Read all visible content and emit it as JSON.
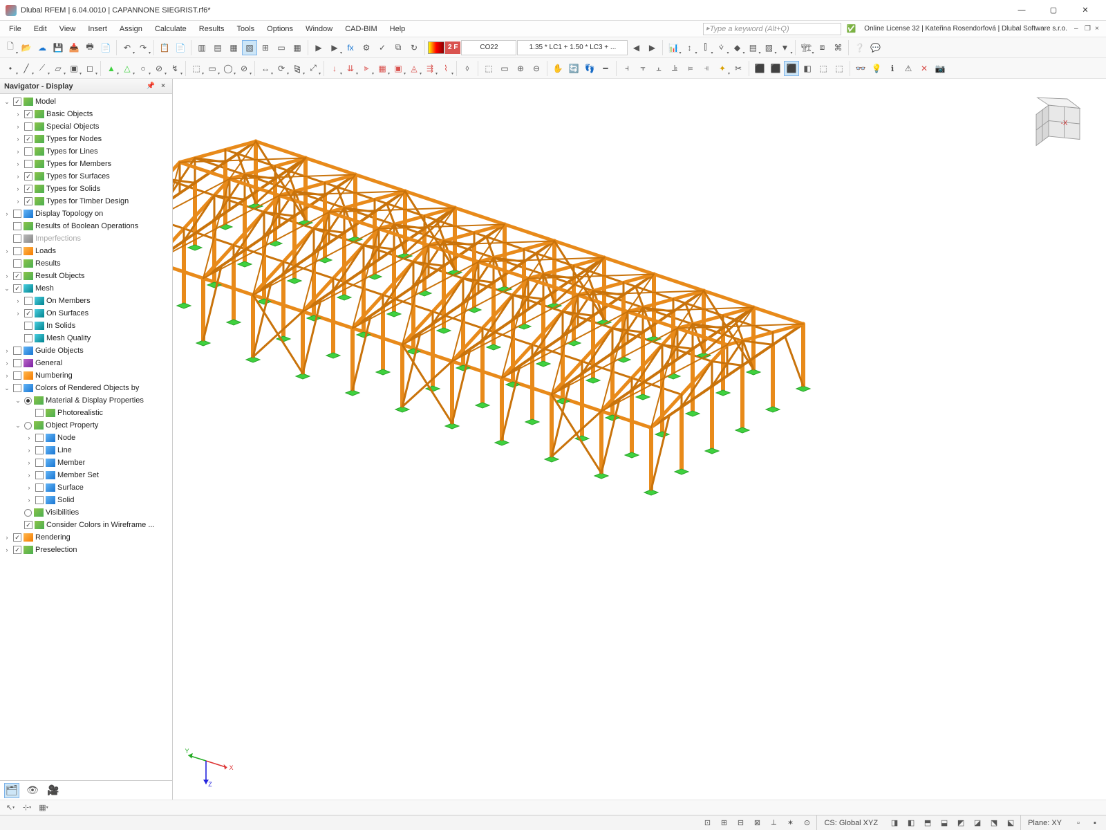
{
  "title": "Dlubal RFEM | 6.04.0010 | CAPANNONE SIEGRIST.rf6*",
  "menus": [
    "File",
    "Edit",
    "View",
    "Insert",
    "Assign",
    "Calculate",
    "Results",
    "Tools",
    "Options",
    "Window",
    "CAD-BIM",
    "Help"
  ],
  "search_placeholder": "Type a keyword (Alt+Q)",
  "license_text": "Online License 32 | Kateřina Rosendorfová | Dlubal Software s.r.o.",
  "toolbar1_combo1": "CO22",
  "toolbar1_combo2": "1.35 * LC1 + 1.50 * LC3 + ...",
  "toolbar1_badge": "2 F",
  "navigator": {
    "title": "Navigator - Display",
    "tree": [
      {
        "d": 0,
        "exp": "open",
        "chk": true,
        "ic": "green",
        "label": "Model"
      },
      {
        "d": 1,
        "exp": "closed",
        "chk": true,
        "ic": "green",
        "label": "Basic Objects"
      },
      {
        "d": 1,
        "exp": "closed",
        "chk": false,
        "ic": "green",
        "label": "Special Objects"
      },
      {
        "d": 1,
        "exp": "closed",
        "chk": true,
        "ic": "green",
        "label": "Types for Nodes"
      },
      {
        "d": 1,
        "exp": "closed",
        "chk": false,
        "ic": "green",
        "label": "Types for Lines"
      },
      {
        "d": 1,
        "exp": "closed",
        "chk": false,
        "ic": "green",
        "label": "Types for Members"
      },
      {
        "d": 1,
        "exp": "closed",
        "chk": true,
        "ic": "green",
        "label": "Types for Surfaces"
      },
      {
        "d": 1,
        "exp": "closed",
        "chk": true,
        "ic": "green",
        "label": "Types for Solids"
      },
      {
        "d": 1,
        "exp": "closed",
        "chk": true,
        "ic": "green",
        "label": "Types for Timber Design"
      },
      {
        "d": 0,
        "exp": "closed",
        "chk": false,
        "ic": "blue",
        "label": "Display Topology on"
      },
      {
        "d": 0,
        "exp": "leaf",
        "chk": false,
        "ic": "green",
        "label": "Results of Boolean Operations"
      },
      {
        "d": 0,
        "exp": "leaf",
        "chk": false,
        "ic": "grey",
        "label": "Imperfections",
        "dim": true
      },
      {
        "d": 0,
        "exp": "closed",
        "chk": false,
        "ic": "orange",
        "label": "Loads"
      },
      {
        "d": 0,
        "exp": "leaf",
        "chk": false,
        "ic": "green",
        "label": "Results"
      },
      {
        "d": 0,
        "exp": "closed",
        "chk": true,
        "ic": "green",
        "label": "Result Objects"
      },
      {
        "d": 0,
        "exp": "open",
        "chk": true,
        "ic": "teal",
        "label": "Mesh"
      },
      {
        "d": 1,
        "exp": "closed",
        "chk": false,
        "ic": "teal",
        "label": "On Members"
      },
      {
        "d": 1,
        "exp": "closed",
        "chk": true,
        "ic": "teal",
        "label": "On Surfaces"
      },
      {
        "d": 1,
        "exp": "leaf",
        "chk": false,
        "ic": "teal",
        "label": "In Solids"
      },
      {
        "d": 1,
        "exp": "leaf",
        "chk": false,
        "ic": "teal",
        "label": "Mesh Quality"
      },
      {
        "d": 0,
        "exp": "closed",
        "chk": false,
        "ic": "blue",
        "label": "Guide Objects"
      },
      {
        "d": 0,
        "exp": "closed",
        "chk": false,
        "ic": "purple",
        "label": "General"
      },
      {
        "d": 0,
        "exp": "closed",
        "chk": false,
        "ic": "orange",
        "label": "Numbering"
      },
      {
        "d": 0,
        "exp": "open",
        "chk": false,
        "ic": "blue",
        "label": "Colors of Rendered Objects by"
      },
      {
        "d": 1,
        "exp": "open",
        "radio": true,
        "rchk": true,
        "ic": "green",
        "label": "Material & Display Properties"
      },
      {
        "d": 2,
        "exp": "leaf",
        "chk": false,
        "ic": "green",
        "label": "Photorealistic"
      },
      {
        "d": 1,
        "exp": "open",
        "radio": true,
        "rchk": false,
        "ic": "green",
        "label": "Object Property"
      },
      {
        "d": 2,
        "exp": "closed",
        "chk": false,
        "ic": "blue",
        "label": "Node"
      },
      {
        "d": 2,
        "exp": "closed",
        "chk": false,
        "ic": "blue",
        "label": "Line"
      },
      {
        "d": 2,
        "exp": "closed",
        "chk": false,
        "ic": "blue",
        "label": "Member"
      },
      {
        "d": 2,
        "exp": "closed",
        "chk": false,
        "ic": "blue",
        "label": "Member Set"
      },
      {
        "d": 2,
        "exp": "closed",
        "chk": false,
        "ic": "blue",
        "label": "Surface"
      },
      {
        "d": 2,
        "exp": "closed",
        "chk": false,
        "ic": "blue",
        "label": "Solid"
      },
      {
        "d": 1,
        "exp": "leaf",
        "radio": true,
        "rchk": false,
        "ic": "green",
        "label": "Visibilities"
      },
      {
        "d": 1,
        "exp": "leaf",
        "chk": true,
        "ic": "green",
        "label": "Consider Colors in Wireframe ..."
      },
      {
        "d": 0,
        "exp": "closed",
        "chk": true,
        "ic": "orange",
        "label": "Rendering"
      },
      {
        "d": 0,
        "exp": "closed",
        "chk": true,
        "ic": "green",
        "label": "Preselection"
      }
    ]
  },
  "axis": {
    "x": "X",
    "y": "Y",
    "z": "Z"
  },
  "status": {
    "cs": "CS: Global XYZ",
    "plane": "Plane: XY"
  },
  "colors": {
    "beam": "#E88A1A",
    "beam_dark": "#C9730B",
    "support": "#3FD13F",
    "accent_blue": "#1976d2"
  }
}
